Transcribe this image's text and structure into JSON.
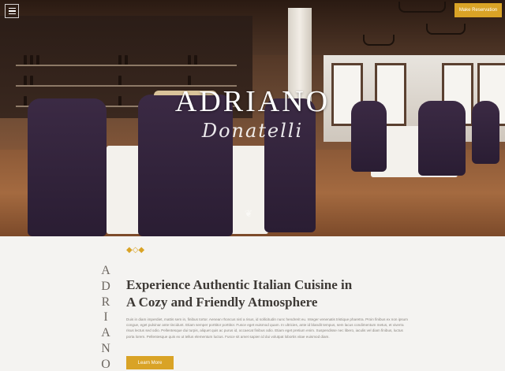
{
  "header": {
    "menu_icon": "hamburger-icon",
    "reserve_label": "Make Reservation",
    "accent_color": "#d9a326"
  },
  "hero": {
    "logo_title": "ADRIANO",
    "logo_script": "Donatelli"
  },
  "about": {
    "vertical_letters": [
      "A",
      "D",
      "R",
      "I",
      "A",
      "N",
      "O"
    ],
    "headline_line1": "Experience Authentic Italian Cuisine in",
    "headline_line2": "A Cozy and Friendly Atmosphere",
    "body": "Duis in diam imperdiet, mattis sem in, finibus tortor. Aenean rhoncus nisl a risus, id sollicitudin nunc hendrerit eu. Integer venenatis tristique pharetra. Proin finibus ex non ipsum congue, eget pulvinar ante tincidunt. Etiam semper porttitor porttitor. Fusce eget euismod quam. In ultricies, ante id blandit tempus, sem lacus condimentum metus, et viverra risus lectus sed odio. Pellentesque dui turpis, aliquet quis ac purus id, occaecat finibus odio. Etiam eget pretium enim. Suspendisse nec libero, iaculis vel diam finibus, luctus porta lorem. Pellentesque quis ex ut tellus elementum luctus. Fusce sit amet sapien id dui volutpat lobortis vitae euismod diam.",
    "button_label": "Learn More"
  }
}
